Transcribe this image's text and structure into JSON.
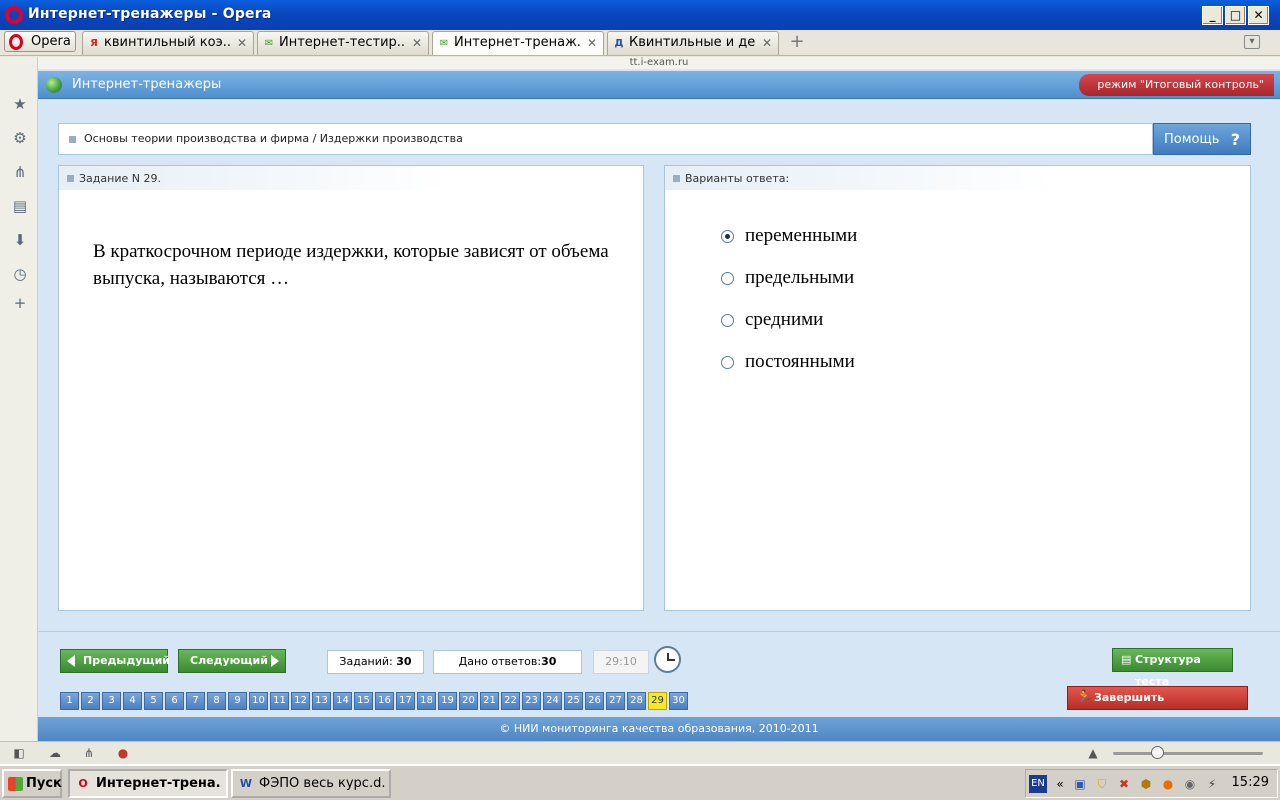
{
  "window": {
    "title": "Интернет-тренажеры - Opera"
  },
  "browser": {
    "menu_label": "Opera",
    "tabs": [
      {
        "label": "квинтильный коэ...",
        "favicon": "Я",
        "active": false
      },
      {
        "label": "Интернет-тестир...",
        "favicon": "✉",
        "active": false
      },
      {
        "label": "Интернет-тренаж...",
        "favicon": "✉",
        "active": true
      },
      {
        "label": "Квинтильные и де...",
        "favicon": "Д",
        "active": false
      }
    ],
    "url_hint": "tt.i-exam.ru"
  },
  "app": {
    "title": "Интернет-тренажеры",
    "mode": "режим \"Итоговый контроль\"",
    "breadcrumb": "Основы теории производства и фирма / Издержки производства",
    "help_label": "Помощь",
    "help_symbol": "?"
  },
  "question": {
    "header": "Задание N 29.",
    "text": "В краткосрочном периоде издержки, которые зависят от объема выпуска, называются …"
  },
  "answers": {
    "header": "Варианты ответа:",
    "options": [
      {
        "label": "переменными",
        "checked": true
      },
      {
        "label": "предельными",
        "checked": false
      },
      {
        "label": "средними",
        "checked": false
      },
      {
        "label": "постоянными",
        "checked": false
      }
    ]
  },
  "nav": {
    "prev_label": "Предыдущий",
    "next_label": "Следующий",
    "tasks_label": "Заданий:",
    "tasks_count": "30",
    "answered_label": "Дано ответов:",
    "answered_count": "30",
    "timer": "29:10",
    "structure_label": "Структура теста",
    "finish_label": "Завершить тестирование",
    "current_question": 29,
    "question_numbers": [
      "1",
      "2",
      "3",
      "4",
      "5",
      "6",
      "7",
      "8",
      "9",
      "10",
      "11",
      "12",
      "13",
      "14",
      "15",
      "16",
      "17",
      "18",
      "19",
      "20",
      "21",
      "22",
      "23",
      "24",
      "25",
      "26",
      "27",
      "28",
      "29",
      "30"
    ]
  },
  "footer": {
    "text": "© НИИ мониторинга качества образования, 2010-2011"
  },
  "taskbar": {
    "start_label": "Пуск",
    "tasks": [
      {
        "label": "Интернет-трена...",
        "active": true
      },
      {
        "label": "ФЭПО весь курс.d...",
        "active": false
      }
    ],
    "lang": "EN",
    "tray_arrow": "«",
    "time": "15:29"
  }
}
